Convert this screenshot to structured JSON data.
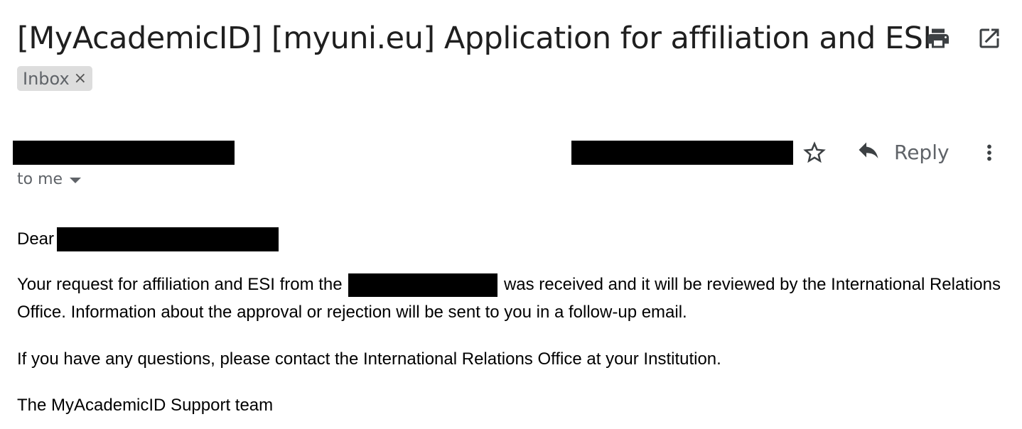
{
  "email": {
    "subject": "[MyAcademicID] [myuni.eu] Application for affiliation and ESI",
    "labels": [
      {
        "name": "Inbox",
        "remove_glyph": "×"
      }
    ],
    "reply_label": "Reply",
    "recipient_summary": "to me",
    "body": {
      "greeting": "Dear",
      "para1_start": "Your request for affiliation and ESI from the",
      "para1_end": "was received and it will be reviewed by the International Relations Office. Information about the approval or rejection will be sent to you in a follow-up email.",
      "para2": "If you have any questions, please contact the International Relations Office at your Institution.",
      "signature": "The MyAcademicID Support team"
    }
  },
  "icons": {
    "print": "print-icon",
    "popout": "open-in-new-window-icon",
    "star": "star-icon",
    "reply": "reply-arrow-icon",
    "more": "more-vertical-icon",
    "dropdown": "caret-down-icon"
  },
  "colors": {
    "icon_gray": "#5f6368",
    "chip_bg": "#dddddd",
    "redaction": "#000000"
  }
}
